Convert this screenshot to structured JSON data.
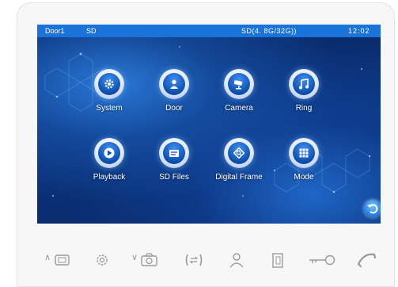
{
  "status_bar": {
    "door": "Door1",
    "storage": "SD",
    "capacity": "SD(4. 8G/32G))",
    "time": "12:02"
  },
  "menu": {
    "items": [
      {
        "label": "System",
        "icon": "gear-icon"
      },
      {
        "label": "Door",
        "icon": "person-icon"
      },
      {
        "label": "Camera",
        "icon": "camera-icon"
      },
      {
        "label": "Ring",
        "icon": "music-note-icon"
      },
      {
        "label": "Playback",
        "icon": "play-icon"
      },
      {
        "label": "SD Files",
        "icon": "sd-card-icon"
      },
      {
        "label": "Digital Frame",
        "icon": "picture-frame-icon"
      },
      {
        "label": "Mode",
        "icon": "grid-icon"
      }
    ]
  },
  "hardware_keys": {
    "items": [
      {
        "name": "monitor-key",
        "icon": "monitor-icon",
        "prefix": "∧"
      },
      {
        "name": "settings-key",
        "icon": "gear-icon"
      },
      {
        "name": "snapshot-key",
        "icon": "camera-icon",
        "prefix": "∨"
      },
      {
        "name": "transfer-key",
        "icon": "transfer-icon"
      },
      {
        "name": "user-key",
        "icon": "person-icon"
      },
      {
        "name": "door-key",
        "icon": "door-icon"
      },
      {
        "name": "unlock-key",
        "icon": "key-icon"
      },
      {
        "name": "call-key",
        "icon": "handset-icon"
      }
    ]
  },
  "colors": {
    "status_bar": "#1a73d9",
    "screen_dark": "#0a2a6a",
    "icon_blue": "#0d4fae",
    "key_gray": "#9a9a9a"
  }
}
